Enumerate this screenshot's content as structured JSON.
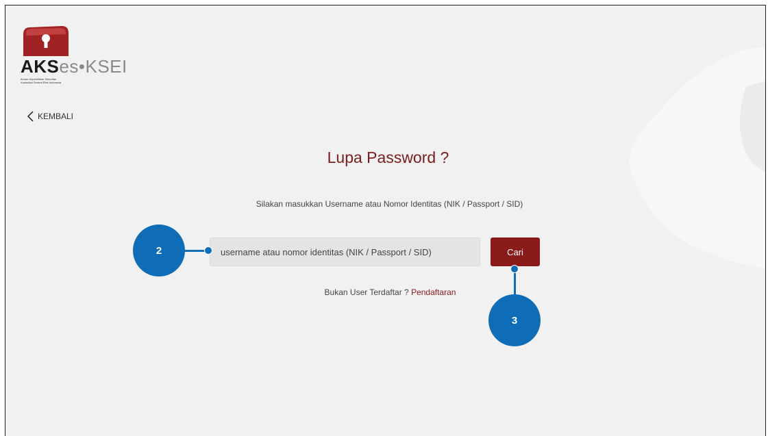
{
  "brand": {
    "name_bold": "AKS",
    "name_es": "es",
    "name_sep": "•",
    "name_ksei": "KSEI",
    "tagline_line1": "Acuan Kepemilikan Sekuritas",
    "tagline_line2": "Kustodian Sentral Efek Indonesia",
    "accent_color": "#8b1a1a"
  },
  "nav": {
    "back_label": "KEMBALI",
    "back_icon": "chevron-left-icon"
  },
  "page": {
    "title": "Lupa Password ?",
    "instruction": "Silakan masukkan Username atau Nomor Identitas (NIK / Passport / SID)"
  },
  "form": {
    "identity_placeholder": "username atau nomor identitas (NIK / Passport / SID)",
    "search_button_label": "Cari"
  },
  "footer_prompt": {
    "text": "Bukan User Terdaftar ? ",
    "link_label": "Pendaftaran"
  },
  "annotations": {
    "marker_input": "2",
    "marker_button": "3",
    "marker_color": "#0f6db7"
  }
}
